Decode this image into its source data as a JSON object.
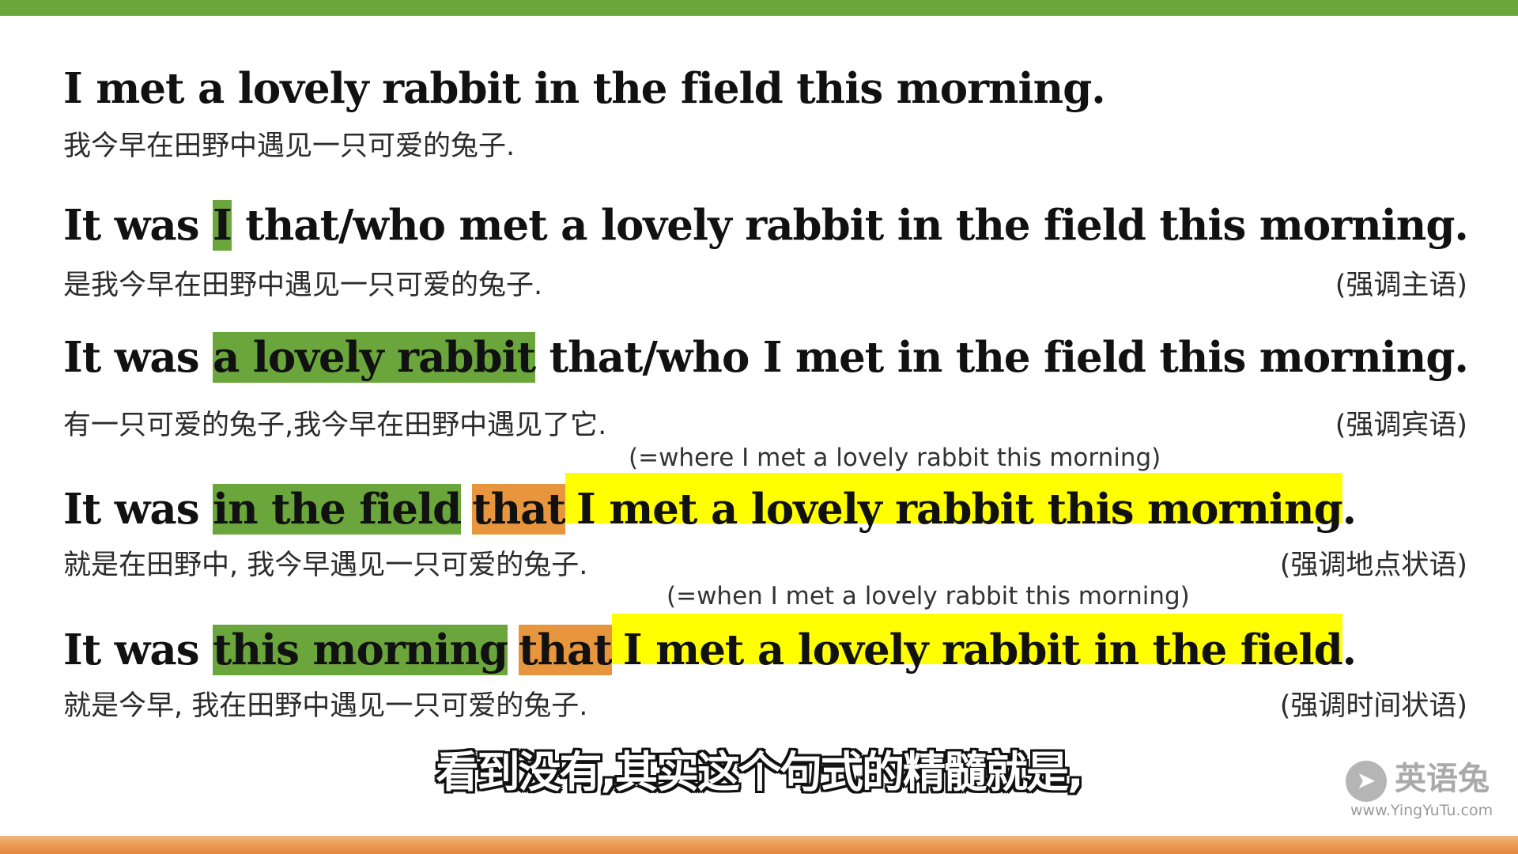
{
  "sentences": [
    {
      "english": "I met a lovely rabbit in the field this morning.",
      "chinese": "我今早在田野中遇见一只可爱的兔子.",
      "tag": ""
    },
    {
      "lead": "It was ",
      "focus": "I",
      "rest": " that/who met a lovely rabbit in the field this morning.",
      "chinese": "是我今早在田野中遇见一只可爱的兔子.",
      "tag": "(强调主语)"
    },
    {
      "lead": "It was ",
      "focus": "a lovely rabbit",
      "rest": " that/who I met in the field this morning.",
      "chinese": "有一只可爱的兔子,我今早在田野中遇见了它.",
      "tag": "(强调宾语)"
    },
    {
      "note": "(=where I met a lovely rabbit this morning)",
      "lead": "It was ",
      "focus": "in the field",
      "that": "that",
      "clause": "I met a lovely rabbit this morning",
      "end": ".",
      "chinese": "就是在田野中, 我今早遇见一只可爱的兔子.",
      "tag": "(强调地点状语)"
    },
    {
      "note": "(=when I met a lovely rabbit this morning)",
      "lead": "It was ",
      "focus": "this morning",
      "that": "that",
      "clause": "I met a lovely rabbit in the field",
      "end": ".",
      "chinese": "就是今早, 我在田野中遇见一只可爱的兔子.",
      "tag": "(强调时间状语)"
    }
  ],
  "subtitle": "看到没有,其实这个句式的精髓就是,",
  "logo": {
    "icon": "rabbit-logo-icon",
    "name": "英语兔",
    "url": "www.YingYuTu.com"
  },
  "colors": {
    "top_bar": "#6aa63b",
    "highlight_focus": "#6aa63b",
    "highlight_that": "#e8963d",
    "highlight_clause": "#ffff00",
    "bottom_bar": "#e7873e"
  }
}
